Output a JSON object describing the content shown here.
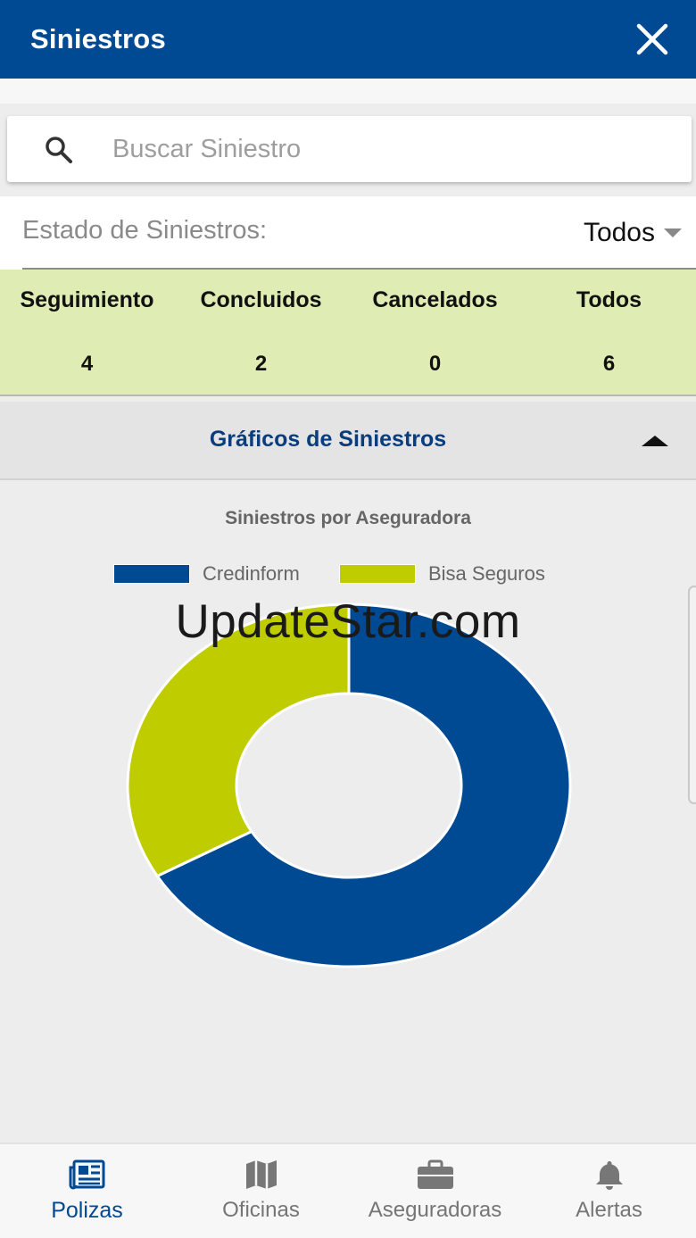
{
  "header": {
    "title": "Siniestros"
  },
  "search": {
    "placeholder": "Buscar Siniestro",
    "value": ""
  },
  "estado": {
    "label": "Estado de Siniestros:",
    "selected": "Todos"
  },
  "counts": [
    {
      "label": "Seguimiento",
      "value": "4"
    },
    {
      "label": "Concluidos",
      "value": "2"
    },
    {
      "label": "Cancelados",
      "value": "0"
    },
    {
      "label": "Todos",
      "value": "6"
    }
  ],
  "section": {
    "title": "Gráficos de Siniestros"
  },
  "colors": {
    "primary": "#004a93",
    "accent": "#bfcc00",
    "counts_bg": "#dfecb3"
  },
  "chart_data": {
    "type": "pie",
    "title": "Siniestros por Aseguradora",
    "legend_position": "top",
    "series": [
      {
        "name": "Credinform",
        "value": 4,
        "color": "#004a93"
      },
      {
        "name": "Bisa Seguros",
        "value": 2,
        "color": "#bfcc00"
      }
    ]
  },
  "watermark": "UpdateStar.com",
  "bottom_nav": [
    {
      "label": "Polizas",
      "icon": "newspaper-icon",
      "active": true
    },
    {
      "label": "Oficinas",
      "icon": "map-icon",
      "active": false
    },
    {
      "label": "Aseguradoras",
      "icon": "briefcase-icon",
      "active": false
    },
    {
      "label": "Alertas",
      "icon": "bell-icon",
      "active": false
    }
  ]
}
